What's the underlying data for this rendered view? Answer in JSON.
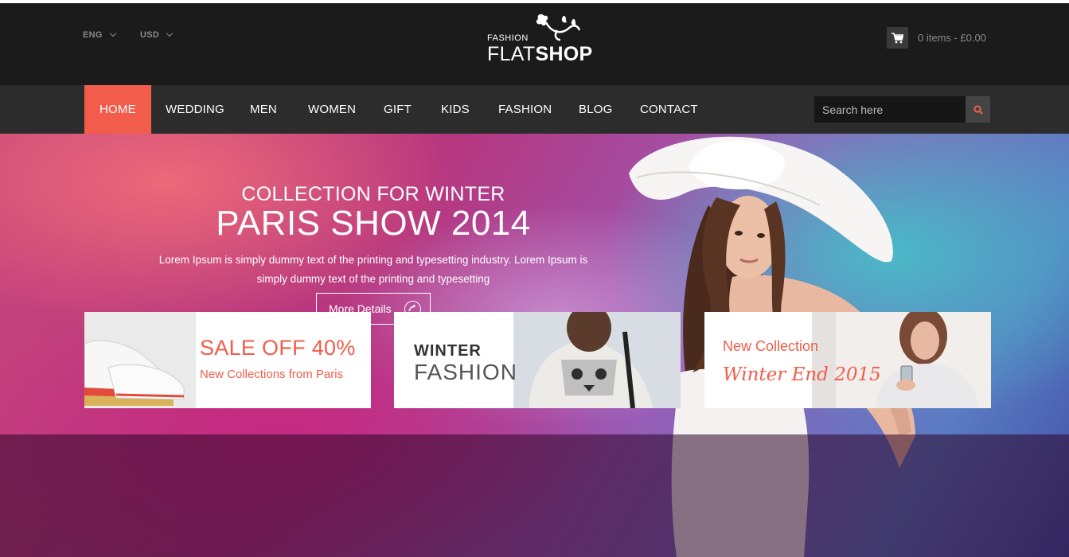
{
  "header": {
    "language": "ENG",
    "currency": "USD",
    "logo_small": "FASHION",
    "logo_flat": "FLAT",
    "logo_shop": "SHOP",
    "cart_text": "0 items - £0.00"
  },
  "nav": {
    "items": [
      {
        "label": "HOME"
      },
      {
        "label": "WEDDING"
      },
      {
        "label": "MEN"
      },
      {
        "label": "WOMEN"
      },
      {
        "label": "GIFT"
      },
      {
        "label": "KIDS"
      },
      {
        "label": "FASHION"
      },
      {
        "label": "BLOG"
      },
      {
        "label": "CONTACT"
      }
    ],
    "search_placeholder": "Search here"
  },
  "hero": {
    "subtitle": "COLLECTION FOR WINTER",
    "title": "PARIS SHOW 2014",
    "description": "Lorem Ipsum is simply dummy text of the printing and typesetting industry. Lorem Ipsum is simply dummy text of the printing and typesetting",
    "button_label": "More Details"
  },
  "banners": [
    {
      "title": "SALE OFF 40%",
      "subtitle": "New Collections from Paris"
    },
    {
      "title": "WINTER",
      "subtitle": "FASHION"
    },
    {
      "title": "New Collection",
      "subtitle": "Winter End 2015"
    }
  ],
  "colors": {
    "accent": "#f25c4a",
    "topbar": "#1b1b1b",
    "navbar": "#2c2c2c"
  }
}
